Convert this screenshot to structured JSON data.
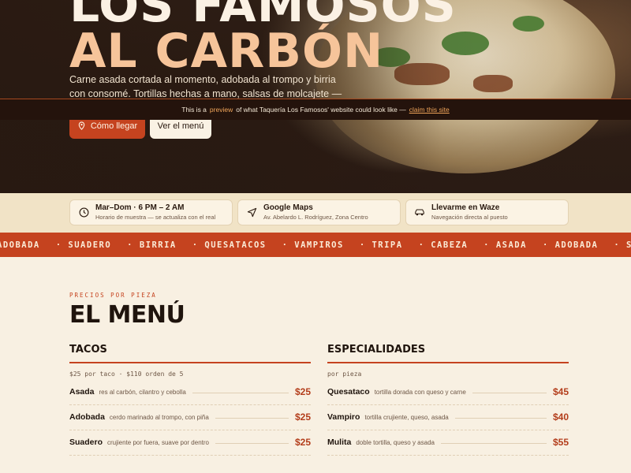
{
  "hero": {
    "title_line1": "LOS FAMOSOS",
    "title_line2": "AL CARBÓN",
    "description": "Carne asada cortada al momento, adobada al trompo y birria con consomé. Tortillas hechas a mano, salsas de molcajete — en la Abelardo L. Rodríguez.",
    "btn_primary": "Cómo llegar",
    "btn_secondary": "Ver el menú"
  },
  "preview_bar": {
    "prefix": "This is a",
    "highlight": "preview",
    "middle": "of what Taquería Los Famosos' website could look like —",
    "link": "claim this site"
  },
  "info_cards": [
    {
      "icon": "clock-icon",
      "title": "Mar–Dom · 6 PM – 2 AM",
      "subtitle": "Horario de muestra — se actualiza con el real"
    },
    {
      "icon": "navigation-arrow-icon",
      "title": "Google Maps",
      "subtitle": "Av. Abelardo L. Rodríguez, Zona Centro"
    },
    {
      "icon": "car-icon",
      "title": "Llevarme en Waze",
      "subtitle": "Navegación directa al puesto"
    }
  ],
  "marquee": [
    "ADOBADA",
    "· SUADERO",
    "· BIRRIA",
    "· QUESATACOS",
    "· VAMPIROS",
    "· TRIPA",
    "· CABEZA",
    "· ASADA",
    "· ADOBADA",
    "· SUADERO",
    "· BIRRIA",
    "· QU"
  ],
  "menu": {
    "kicker": "PRECIOS POR PIEZA",
    "title": "EL MENÚ",
    "tacos": {
      "heading": "TACOS",
      "subtitle": "$25 por taco · $110 orden de 5",
      "items": [
        {
          "name": "Asada",
          "desc": "res al carbón, cilantro y cebolla",
          "price": "$25"
        },
        {
          "name": "Adobada",
          "desc": "cerdo marinado al trompo, con piña",
          "price": "$25"
        },
        {
          "name": "Suadero",
          "desc": "crujiente por fuera, suave por dentro",
          "price": "$25"
        }
      ]
    },
    "especialidades": {
      "heading": "ESPECIALIDADES",
      "subtitle": "por pieza",
      "items": [
        {
          "name": "Quesataco",
          "desc": "tortilla dorada con queso y carne",
          "price": "$45"
        },
        {
          "name": "Vampiro",
          "desc": "tortilla crujiente, queso, asada",
          "price": "$40"
        },
        {
          "name": "Mulita",
          "desc": "doble tortilla, queso y asada",
          "price": "$55"
        }
      ]
    }
  },
  "colors": {
    "accent": "#c5431f",
    "cream": "#f8f0e2",
    "dark": "#24130c"
  }
}
